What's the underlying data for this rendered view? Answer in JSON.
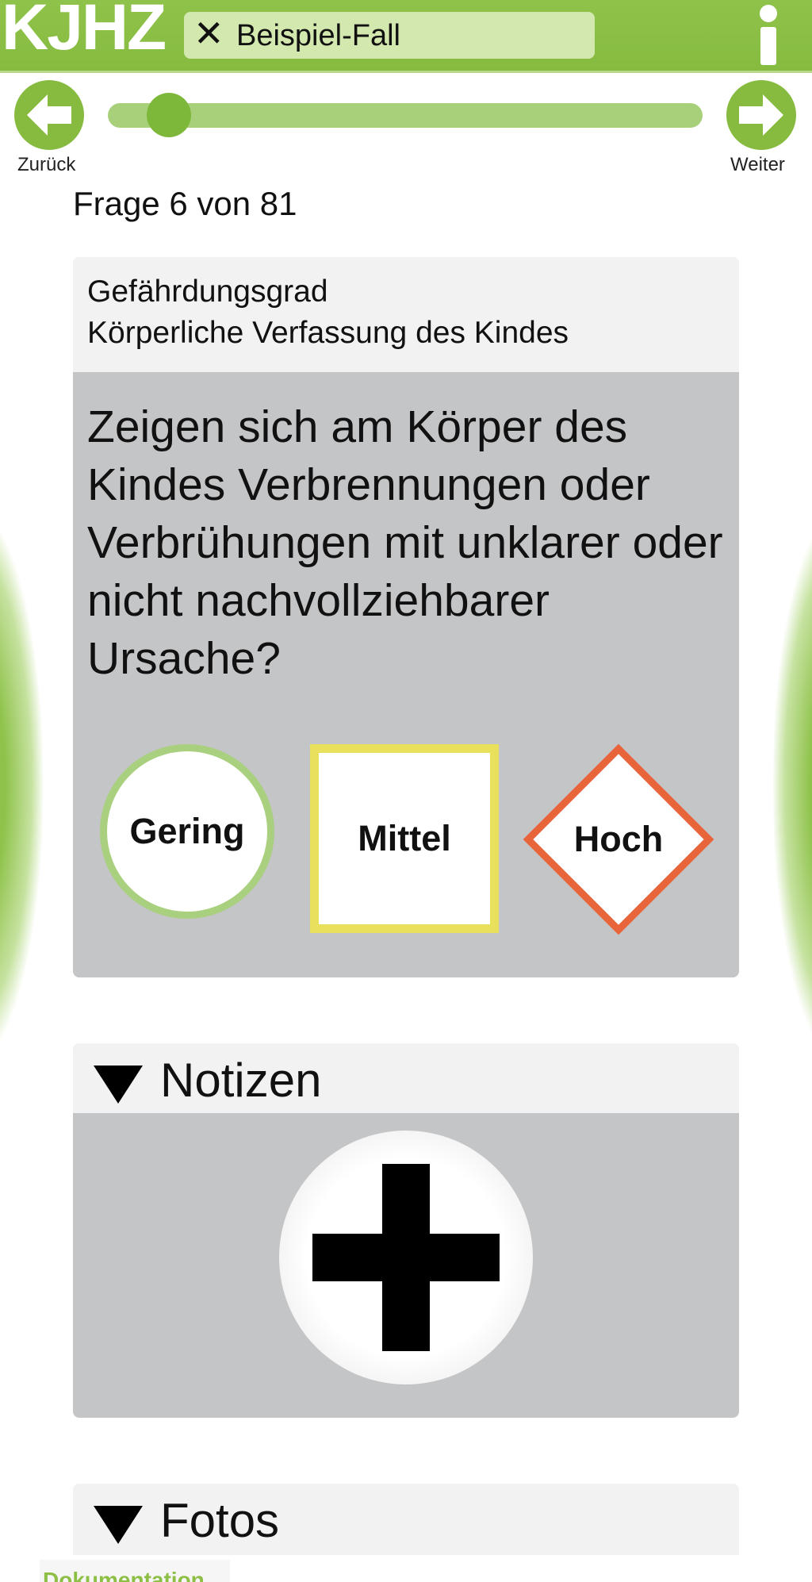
{
  "app": {
    "logo": "KJHZ"
  },
  "header": {
    "case_close_glyph": "✕",
    "case_name": "Beispiel-Fall",
    "info_icon": "info-icon"
  },
  "nav": {
    "back_label": "Zurück",
    "next_label": "Weiter",
    "progress_fraction": 0.074
  },
  "question": {
    "counter": "Frage 6 von 81",
    "category": "Gefährdungsgrad",
    "subcategory": "Körperliche Verfassung des Kindes",
    "text": "Zeigen sich am Körper des Kindes Verbrennungen oder Verbrühungen mit unklarer oder nicht nachvollziehbarer Ursache?",
    "choices": [
      {
        "label": "Gering",
        "shape": "circle",
        "color": "#a9d07e"
      },
      {
        "label": "Mittel",
        "shape": "square",
        "color": "#e9e05c"
      },
      {
        "label": "Hoch",
        "shape": "diamond",
        "color": "#e8643a"
      }
    ]
  },
  "notes": {
    "title": "Notizen",
    "add_icon": "plus-icon"
  },
  "photos": {
    "title": "Fotos"
  },
  "bottom_tab": {
    "label": "Dokumentation"
  },
  "colors": {
    "brand_green": "#86bb40",
    "card_gray": "#c4c5c7",
    "header_light": "#f2f2f2"
  }
}
